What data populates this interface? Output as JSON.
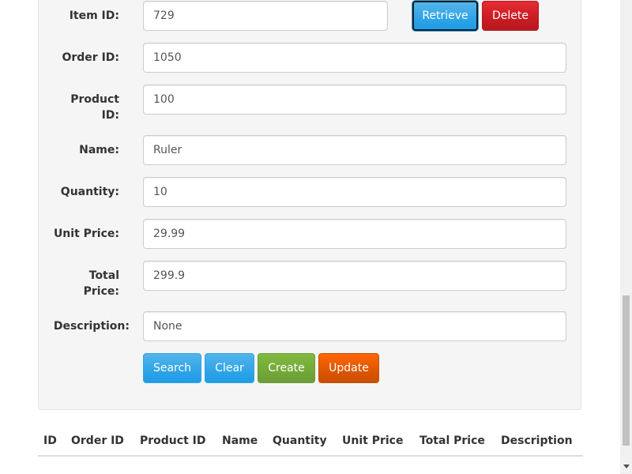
{
  "form": {
    "item_id": {
      "label": "Item ID:",
      "value": "729"
    },
    "order_id": {
      "label": "Order ID:",
      "value": "1050"
    },
    "product_id": {
      "label_line1": "Product",
      "label_line2": "ID:",
      "value": "100"
    },
    "name": {
      "label": "Name:",
      "value": "Ruler"
    },
    "quantity": {
      "label": "Quantity:",
      "value": "10"
    },
    "unit_price": {
      "label": "Unit Price:",
      "value": "29.99"
    },
    "total_price": {
      "label_line1": "Total",
      "label_line2": "Price:",
      "value": "299.9"
    },
    "description": {
      "label": "Description:",
      "value": "None"
    }
  },
  "buttons": {
    "retrieve": "Retrieve",
    "delete": "Delete",
    "search": "Search",
    "clear": "Clear",
    "create": "Create",
    "update": "Update"
  },
  "table": {
    "headers": [
      "ID",
      "Order ID",
      "Product ID",
      "Name",
      "Quantity",
      "Unit Price",
      "Total Price",
      "Description"
    ]
  },
  "colors": {
    "primary": "#2fa4e7",
    "danger": "#c71c22",
    "success": "#73a839",
    "warning": "#dd5600"
  }
}
